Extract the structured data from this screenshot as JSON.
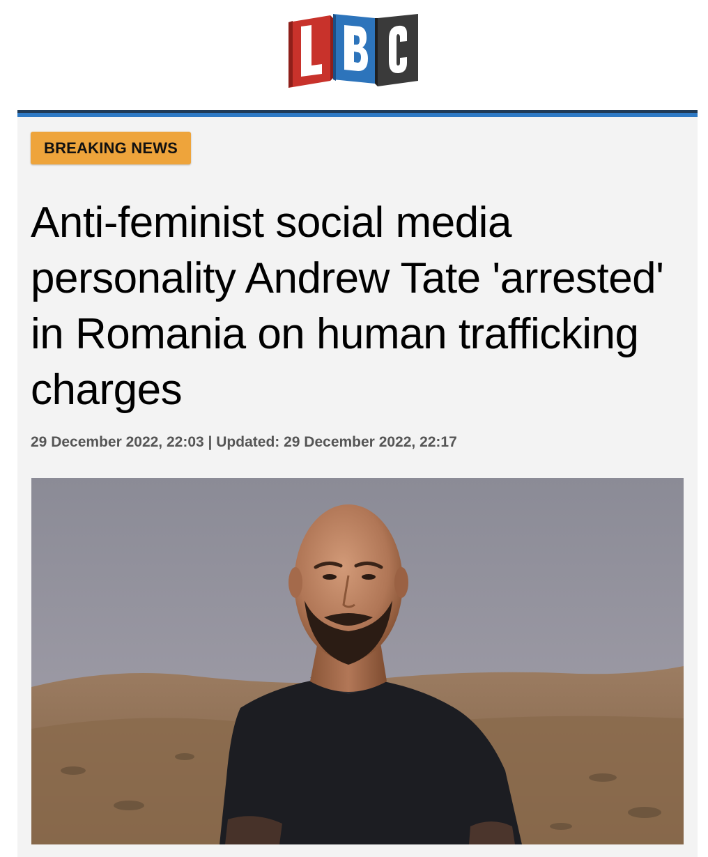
{
  "brand": {
    "logo_letters": [
      "L",
      "B",
      "C"
    ],
    "colors": {
      "l_panel": "#c8322b",
      "b_panel": "#2d74bb",
      "c_panel": "#3a3a3a",
      "rule_dark": "#1f3a57",
      "rule_accent": "#2e79c4"
    }
  },
  "article": {
    "badge": "BREAKING NEWS",
    "badge_color": "#eea43b",
    "headline": "Anti-feminist social media personality Andrew Tate 'arrested' in Romania on human trafficking charges",
    "published": "29 December 2022, 22:03",
    "separator": "|",
    "updated_label": "Updated:",
    "updated": "29 December 2022, 22:17",
    "hero_image": "photo-of-man-in-black-t-shirt-in-desert"
  }
}
